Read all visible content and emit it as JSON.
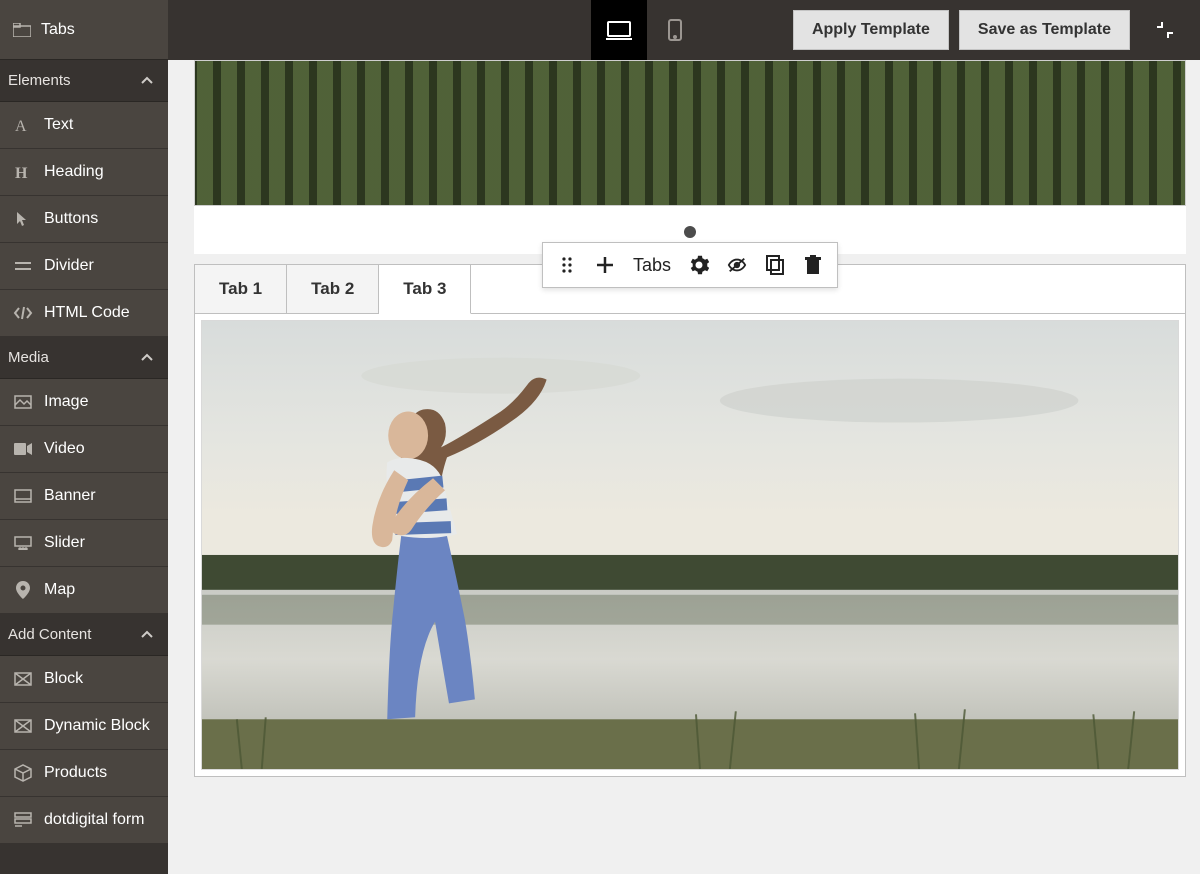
{
  "sidebar": {
    "top_tab": "Tabs",
    "sections": {
      "elements": "Elements",
      "media": "Media",
      "add_content": "Add Content"
    },
    "elements_items": [
      "Text",
      "Heading",
      "Buttons",
      "Divider",
      "HTML Code"
    ],
    "media_items": [
      "Image",
      "Video",
      "Banner",
      "Slider",
      "Map"
    ],
    "addcontent_items": [
      "Block",
      "Dynamic Block",
      "Products",
      "dotdigital form"
    ]
  },
  "topbar": {
    "apply_template": "Apply Template",
    "save_template": "Save as Template"
  },
  "canvas": {
    "tabs": [
      "Tab 1",
      "Tab 2",
      "Tab 3"
    ],
    "active_tab_index": 2
  },
  "float_toolbar": {
    "label": "Tabs"
  }
}
